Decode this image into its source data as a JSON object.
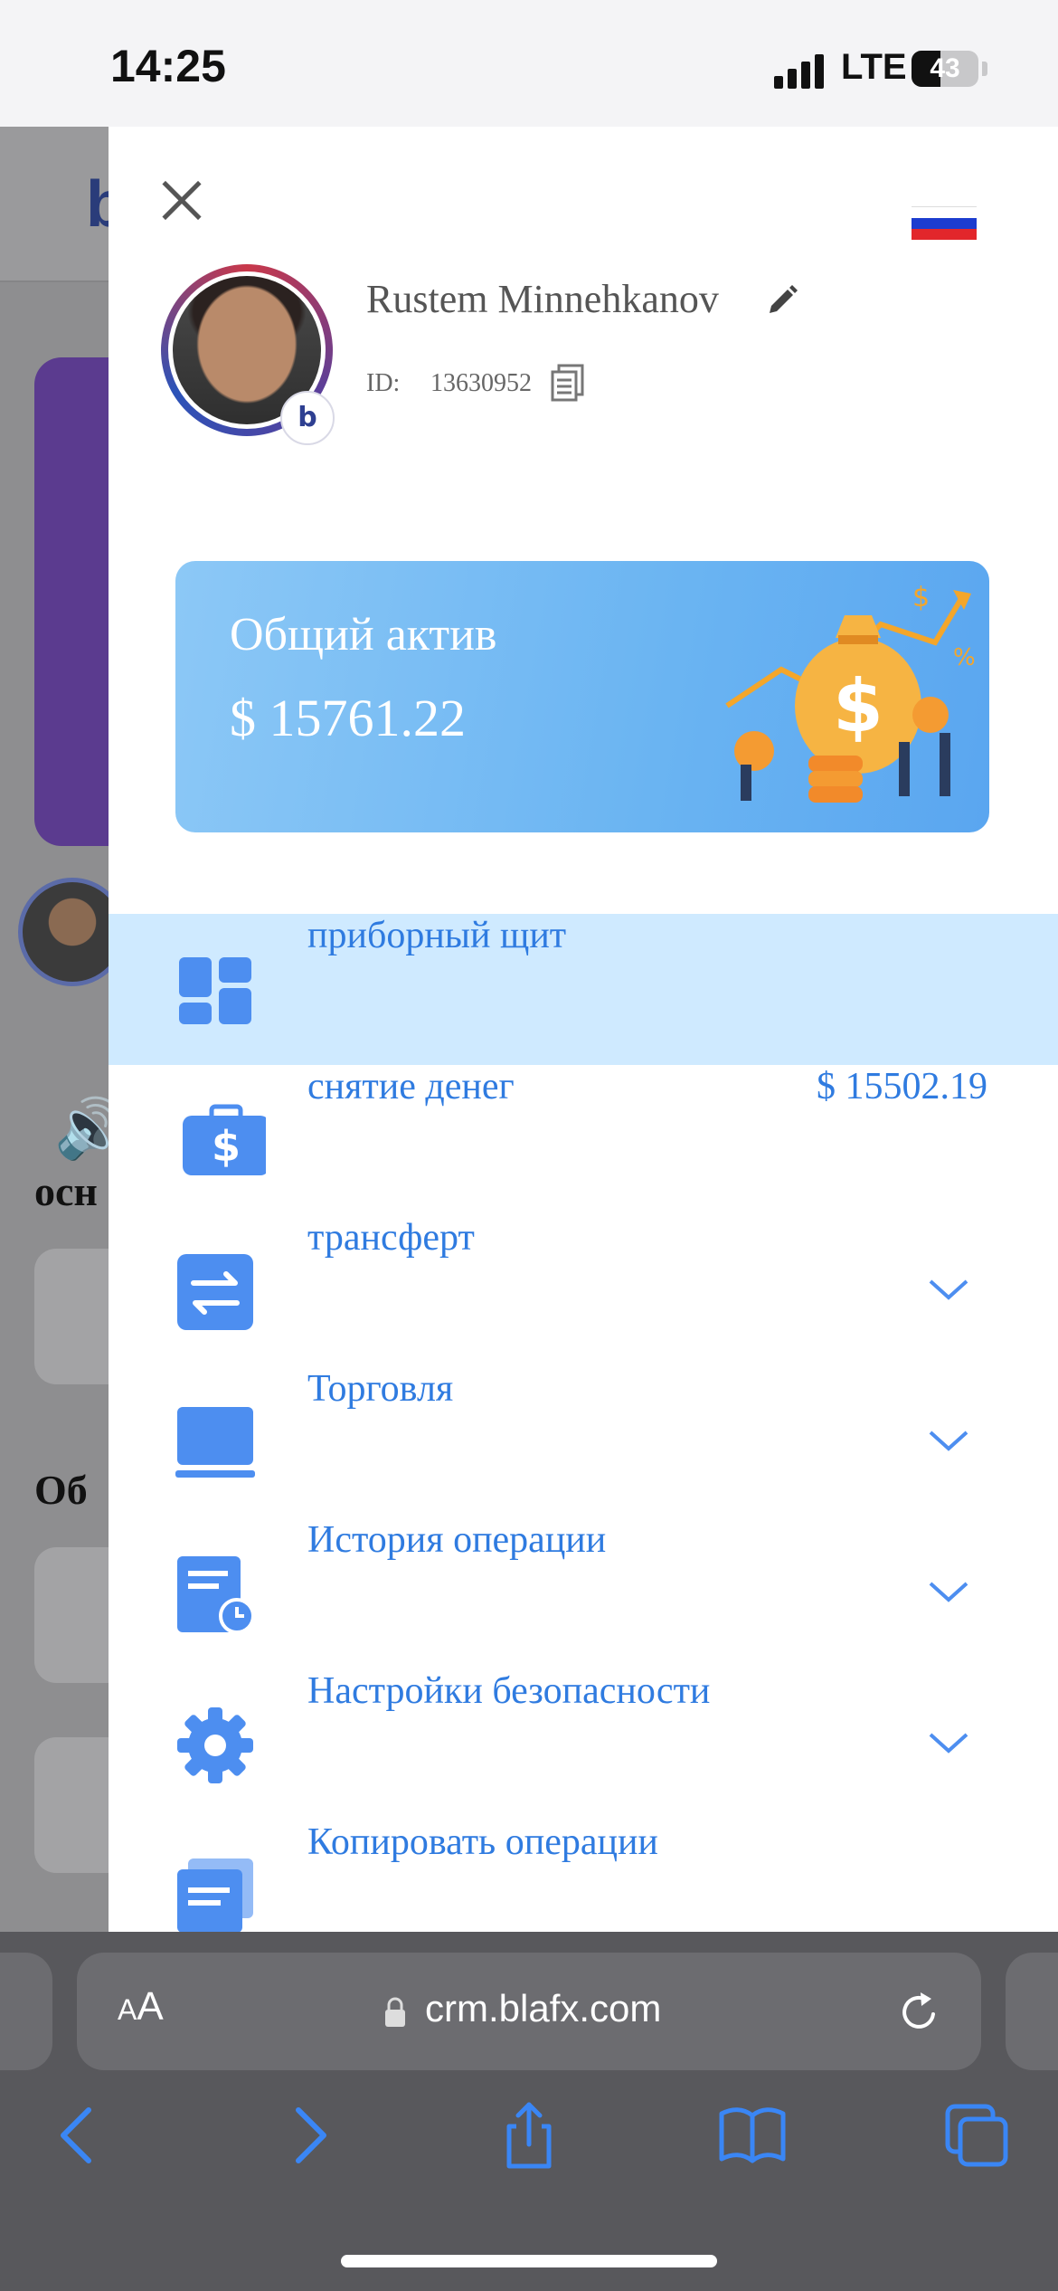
{
  "status_bar": {
    "time": "14:25",
    "network": "LTE",
    "battery_level": "43"
  },
  "background_page": {
    "heading_1": "осн",
    "heading_2": "Об"
  },
  "drawer": {
    "user": {
      "name": "Rustem Minnehkanov",
      "id_label": "ID:",
      "id_value": "13630952"
    },
    "asset_card": {
      "title": "Общий актив",
      "value": "$ 15761.22"
    },
    "menu": [
      {
        "label": "приборный щит",
        "icon": "dashboard-icon",
        "active": true
      },
      {
        "label": "снятие денег",
        "icon": "withdraw-icon",
        "amount": "$ 15502.19"
      },
      {
        "label": "трансферт",
        "icon": "transfer-icon",
        "expandable": true
      },
      {
        "label": "Торговля",
        "icon": "trading-icon",
        "expandable": true
      },
      {
        "label": "История операции",
        "icon": "history-icon",
        "expandable": true
      },
      {
        "label": "Настройки безопасности",
        "icon": "gear-icon",
        "expandable": true
      },
      {
        "label": "Копировать операции",
        "icon": "copy-trading-icon"
      }
    ],
    "language_flag": "russian-flag"
  },
  "browser": {
    "text_size_label": "AA",
    "url": "crm.blafx.com"
  },
  "colors": {
    "accent": "#2f7be0",
    "active_row": "#cfeaff",
    "card_gradient_start": "#8cc8f6",
    "card_gradient_end": "#5aa6f0"
  }
}
